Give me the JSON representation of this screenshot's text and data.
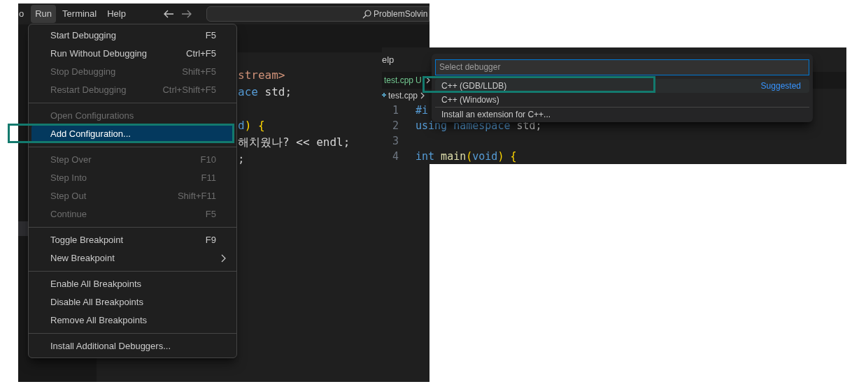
{
  "left_window": {
    "menubar": [
      {
        "label": "o",
        "selected": false
      },
      {
        "label": "Run",
        "selected": true
      },
      {
        "label": "Terminal",
        "selected": false
      },
      {
        "label": "Help",
        "selected": false
      }
    ],
    "search": {
      "value": "ProblemSolvin"
    },
    "code_lines": [
      {
        "tokens": [
          {
            "text": "stream>",
            "kind": "string"
          }
        ]
      },
      {
        "tokens": [
          {
            "text": "ace",
            "kind": "keyword"
          },
          {
            "text": " std;",
            "kind": "plain"
          }
        ]
      },
      {
        "blank": true
      },
      {
        "tokens": [
          {
            "text": "d",
            "kind": "keyword"
          },
          {
            "text": ")",
            "kind": "bracket"
          },
          {
            "text": " {",
            "kind": "bracket"
          }
        ]
      },
      {
        "tokens": [
          {
            "text": "해치웠나? << endl;",
            "kind": "plain"
          }
        ]
      },
      {
        "tokens": [
          {
            "text": ";",
            "kind": "plain"
          }
        ]
      }
    ],
    "menu": {
      "groups": [
        [
          {
            "label": "Start Debugging",
            "shortcut": "F5",
            "disabled": false,
            "selected": false,
            "submenu": false,
            "annotated": false
          },
          {
            "label": "Run Without Debugging",
            "shortcut": "Ctrl+F5",
            "disabled": false,
            "selected": false,
            "submenu": false,
            "annotated": false
          },
          {
            "label": "Stop Debugging",
            "shortcut": "Shift+F5",
            "disabled": true,
            "selected": false,
            "submenu": false,
            "annotated": false
          },
          {
            "label": "Restart Debugging",
            "shortcut": "Ctrl+Shift+F5",
            "disabled": true,
            "selected": false,
            "submenu": false,
            "annotated": false
          }
        ],
        [
          {
            "label": "Open Configurations",
            "disabled": true,
            "selected": false,
            "submenu": false,
            "annotated": false
          },
          {
            "label": "Add Configuration...",
            "disabled": false,
            "selected": true,
            "submenu": false,
            "annotated": true
          }
        ],
        [
          {
            "label": "Step Over",
            "shortcut": "F10",
            "disabled": true,
            "selected": false,
            "submenu": false,
            "annotated": false
          },
          {
            "label": "Step Into",
            "shortcut": "F11",
            "disabled": true,
            "selected": false,
            "submenu": false,
            "annotated": false
          },
          {
            "label": "Step Out",
            "shortcut": "Shift+F11",
            "disabled": true,
            "selected": false,
            "submenu": false,
            "annotated": false
          },
          {
            "label": "Continue",
            "shortcut": "F5",
            "disabled": true,
            "selected": false,
            "submenu": false,
            "annotated": false
          }
        ],
        [
          {
            "label": "Toggle Breakpoint",
            "shortcut": "F9",
            "disabled": false,
            "selected": false,
            "submenu": false,
            "annotated": false
          },
          {
            "label": "New Breakpoint",
            "disabled": false,
            "selected": false,
            "submenu": true,
            "annotated": false
          }
        ],
        [
          {
            "label": "Enable All Breakpoints",
            "disabled": false,
            "selected": false,
            "submenu": false,
            "annotated": false
          },
          {
            "label": "Disable All Breakpoints",
            "disabled": false,
            "selected": false,
            "submenu": false,
            "annotated": false
          },
          {
            "label": "Remove All Breakpoints",
            "disabled": false,
            "selected": false,
            "submenu": false,
            "annotated": false
          }
        ],
        [
          {
            "label": "Install Additional Debuggers...",
            "disabled": false,
            "selected": false,
            "submenu": false,
            "annotated": false
          }
        ]
      ]
    }
  },
  "right_window": {
    "menubar_fragment": "elp",
    "tab": {
      "name": "test.cpp",
      "status": "U"
    },
    "breadcrumb": "test.cpp",
    "code_lines": [
      {
        "number": "1",
        "tokens": [
          {
            "text": "#i",
            "kind": "keyword"
          }
        ]
      },
      {
        "number": "2",
        "tokens": [
          {
            "text": "using",
            "kind": "keyword"
          },
          {
            "text": " namespace",
            "kind": "keyword"
          },
          {
            "text": " std;",
            "kind": "plain"
          }
        ]
      },
      {
        "number": "3",
        "blank": true
      },
      {
        "number": "4",
        "tokens": [
          {
            "text": "int",
            "kind": "keyword"
          },
          {
            "text": " main",
            "kind": "function"
          },
          {
            "text": "(",
            "kind": "bracket"
          },
          {
            "text": "void",
            "kind": "keyword"
          },
          {
            "text": ")",
            "kind": "bracket"
          },
          {
            "text": " {",
            "kind": "bracket"
          }
        ]
      }
    ]
  },
  "quick_pick": {
    "placeholder": "Select debugger",
    "items": [
      {
        "label": "C++ (GDB/LLDB)",
        "badge": "Suggested",
        "selected": true,
        "separator_before": false,
        "annotated": true
      },
      {
        "label": "C++ (Windows)",
        "selected": false,
        "separator_before": false,
        "annotated": false
      },
      {
        "label": "Install an extension for C++...",
        "selected": false,
        "separator_before": true,
        "annotated": false
      }
    ]
  }
}
